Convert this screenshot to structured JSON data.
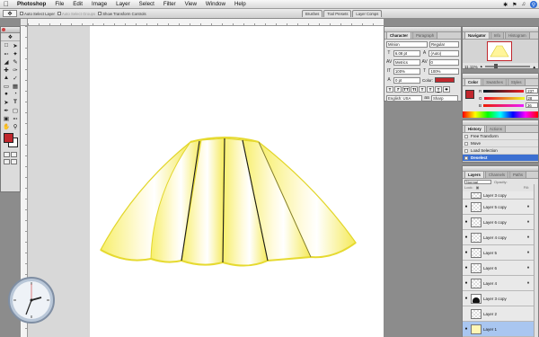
{
  "menubar": {
    "app": "Photoshop",
    "items": [
      "File",
      "Edit",
      "Image",
      "Layer",
      "Select",
      "Filter",
      "View",
      "Window",
      "Help"
    ]
  },
  "options": {
    "auto_select_layer": "Auto Select Layer",
    "auto_select_groups": "Auto Select Groups",
    "show_transform_controls": "Show Transform Controls",
    "wells": [
      "Brushes",
      "Tool Presets",
      "Layer Comps"
    ]
  },
  "character": {
    "tabs": [
      "Character",
      "Paragraph"
    ],
    "font_family": "Minion",
    "font_style": "Regular",
    "size": "6.08 pt",
    "leading": "(Auto)",
    "kerning": "Metrics",
    "tracking": "0",
    "vscale": "100%",
    "hscale": "100%",
    "baseline": "0 pt",
    "color_label": "Color:",
    "language": "English: USA",
    "antialias": "Sharp",
    "style_buttons": [
      "T",
      "T",
      "TT",
      "Tt",
      "T",
      "T",
      "T",
      "T"
    ]
  },
  "navigator": {
    "tabs": [
      "Navigator",
      "Info",
      "Histogram"
    ],
    "zoom": "11.11%"
  },
  "color": {
    "tabs": [
      "Color",
      "Swatches",
      "Styles"
    ],
    "r_label": "R",
    "g_label": "G",
    "b_label": "B",
    "r": "237",
    "g": "28",
    "b": "36",
    "accent": "#c1272d"
  },
  "history": {
    "tabs": [
      "History",
      "Actions"
    ],
    "items": [
      "Free Transform",
      "Move",
      "Load Selection",
      "Deselect"
    ]
  },
  "layers": {
    "tabs": [
      "Layers",
      "Channels",
      "Paths"
    ],
    "blend_mode": "Normal",
    "opacity_label": "Opacity:",
    "lock_label": "Lock:",
    "fill_label": "Fill:",
    "items": [
      "Layer 3 copy",
      "Layer 5 copy",
      "Layer 6 copy",
      "Layer 4 copy",
      "Layer 5",
      "Layer 6",
      "Layer 4",
      "Layer 3 copy",
      "Layer 2",
      "Layer 1"
    ]
  }
}
